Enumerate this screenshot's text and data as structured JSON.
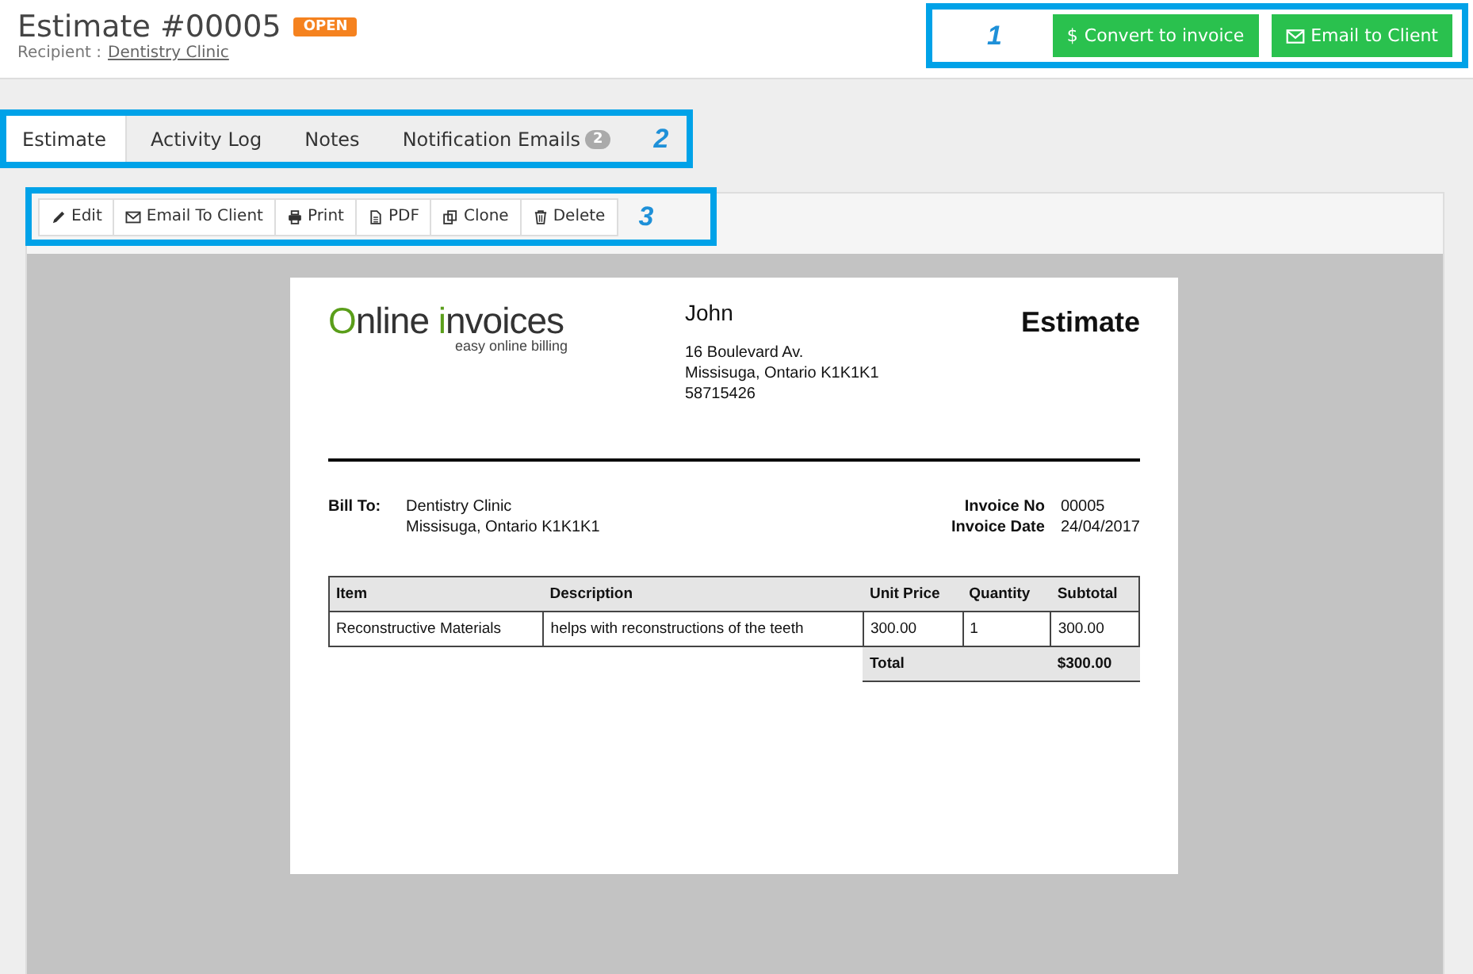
{
  "header": {
    "title": "Estimate #00005",
    "status": "OPEN",
    "recipient_label": "Recipient :",
    "recipient": "Dentistry Clinic"
  },
  "actions": {
    "callout": "1",
    "buttons": [
      {
        "kind": "convert",
        "icon": "$",
        "label": "Convert to invoice"
      },
      {
        "kind": "email",
        "label": "Email to Client"
      }
    ]
  },
  "tabs": {
    "callout": "2",
    "items": [
      {
        "label": "Estimate",
        "selected": true
      },
      {
        "label": "Activity Log",
        "selected": false
      },
      {
        "label": "Notes",
        "selected": false
      },
      {
        "label": "Notification Emails",
        "badge": "2",
        "selected": false
      }
    ]
  },
  "toolbar": {
    "callout": "3",
    "buttons": [
      {
        "kind": "edit",
        "label": "Edit"
      },
      {
        "kind": "email",
        "label": "Email To Client"
      },
      {
        "kind": "print",
        "label": "Print"
      },
      {
        "kind": "pdf",
        "label": "PDF"
      },
      {
        "kind": "clone",
        "label": "Clone"
      },
      {
        "kind": "delete",
        "label": "Delete"
      }
    ]
  },
  "document": {
    "logo": {
      "first": "Online",
      "second": "invoices",
      "tagline": "easy online billing"
    },
    "sender": {
      "name": "John",
      "lines": [
        "16 Boulevard Av.",
        "Missisuga, Ontario K1K1K1",
        "58715426"
      ]
    },
    "title": "Estimate",
    "bill_to": {
      "label": "Bill To:",
      "lines": [
        "Dentistry Clinic",
        "Missisuga, Ontario K1K1K1"
      ]
    },
    "meta": [
      {
        "label": "Invoice No",
        "value": "00005"
      },
      {
        "label": "Invoice Date",
        "value": "24/04/2017"
      }
    ],
    "table": {
      "columns": [
        "Item",
        "Description",
        "Unit Price",
        "Quantity",
        "Subtotal"
      ],
      "rows": [
        [
          "Reconstructive Materials",
          "helps with reconstructions of the teeth",
          "300.00",
          "1",
          "300.00"
        ]
      ],
      "total_label": "Total",
      "total": "$300.00"
    }
  }
}
